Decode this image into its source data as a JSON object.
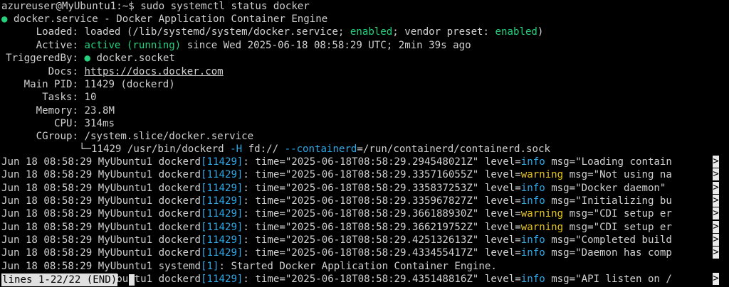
{
  "prompt": {
    "user_host": "azureuser@MyUbuntu1:~$",
    "command": "sudo systemctl status docker"
  },
  "status": {
    "dot": "●",
    "title": "docker.service - Docker Application Container Engine",
    "loaded": {
      "label": "Loaded:",
      "pre": "loaded (/lib/systemd/system/docker.service; ",
      "enabled": "enabled",
      "mid": "; vendor preset: ",
      "preset": "enabled",
      "post": ")"
    },
    "active": {
      "label": "Active:",
      "state": "active (running)",
      "since": " since Wed 2025-06-18 08:58:29 UTC; 2min 39s ago"
    },
    "triggered": {
      "label": "TriggeredBy:",
      "dot": "●",
      "value": "docker.socket"
    },
    "docs": {
      "label": "Docs:",
      "value": "https://docs.docker.com"
    },
    "main_pid": {
      "label": "Main PID:",
      "value": "11429 (dockerd)"
    },
    "tasks": {
      "label": "Tasks:",
      "value": "10"
    },
    "memory": {
      "label": "Memory:",
      "value": "23.8M"
    },
    "cpu": {
      "label": "CPU:",
      "value": "314ms"
    },
    "cgroup": {
      "label": "CGroup:",
      "value": "/system.slice/docker.service",
      "branch": "└─",
      "proc": "11429 /usr/bin/dockerd",
      "flag_h": "-H",
      "fd": "fd://",
      "flag_c": "--containerd",
      "sock": "=/run/containerd/containerd.sock"
    }
  },
  "logs": [
    {
      "prefix": "Jun 18 08:58:29 MyUbuntu1 dockerd",
      "pid": "[11429]",
      "time": ": time=\"2025-06-18T08:58:29.294548021Z\" level=",
      "level": "info",
      "msg": " msg=\"Loading contain",
      "trunc": ">"
    },
    {
      "prefix": "Jun 18 08:58:29 MyUbuntu1 dockerd",
      "pid": "[11429]",
      "time": ": time=\"2025-06-18T08:58:29.335716055Z\" level=",
      "level": "warning",
      "msg": " msg=\"Not using na",
      "trunc": ">"
    },
    {
      "prefix": "Jun 18 08:58:29 MyUbuntu1 dockerd",
      "pid": "[11429]",
      "time": ": time=\"2025-06-18T08:58:29.335837253Z\" level=",
      "level": "info",
      "msg": " msg=\"Docker daemon\" ",
      "trunc": ">"
    },
    {
      "prefix": "Jun 18 08:58:29 MyUbuntu1 dockerd",
      "pid": "[11429]",
      "time": ": time=\"2025-06-18T08:58:29.335967827Z\" level=",
      "level": "info",
      "msg": " msg=\"Initializing bu",
      "trunc": ">"
    },
    {
      "prefix": "Jun 18 08:58:29 MyUbuntu1 dockerd",
      "pid": "[11429]",
      "time": ": time=\"2025-06-18T08:58:29.366188930Z\" level=",
      "level": "warning",
      "msg": " msg=\"CDI setup er",
      "trunc": ">"
    },
    {
      "prefix": "Jun 18 08:58:29 MyUbuntu1 dockerd",
      "pid": "[11429]",
      "time": ": time=\"2025-06-18T08:58:29.366219752Z\" level=",
      "level": "warning",
      "msg": " msg=\"CDI setup er",
      "trunc": ">"
    },
    {
      "prefix": "Jun 18 08:58:29 MyUbuntu1 dockerd",
      "pid": "[11429]",
      "time": ": time=\"2025-06-18T08:58:29.425132613Z\" level=",
      "level": "info",
      "msg": " msg=\"Completed build",
      "trunc": ">"
    },
    {
      "prefix": "Jun 18 08:58:29 MyUbuntu1 dockerd",
      "pid": "[11429]",
      "time": ": time=\"2025-06-18T08:58:29.433455417Z\" level=",
      "level": "info",
      "msg": " msg=\"Daemon has comp",
      "trunc": ">"
    },
    {
      "prefix": "Jun 18 08:58:29 MyUbuntu1 systemd",
      "pid": "[1]",
      "time": ": Started Docker Application Container Engine.",
      "level": "",
      "msg": "",
      "trunc": ""
    },
    {
      "prefix": "Jun 18 08:58:29 MyUbuntu1 dockerd",
      "pid": "[11429]",
      "time": ": time=\"2025-06-18T08:58:29.435148816Z\" level=",
      "level": "info",
      "msg": " msg=\"API listen on /",
      "trunc": ">"
    }
  ],
  "colors": {
    "green": "#26d07c",
    "cyan": "#2ea8e6",
    "yellow": "#e5c41a",
    "background": "#000000",
    "foreground": "#d0d0d0"
  },
  "pager": {
    "text": "lines 1-22/22 (END)"
  }
}
